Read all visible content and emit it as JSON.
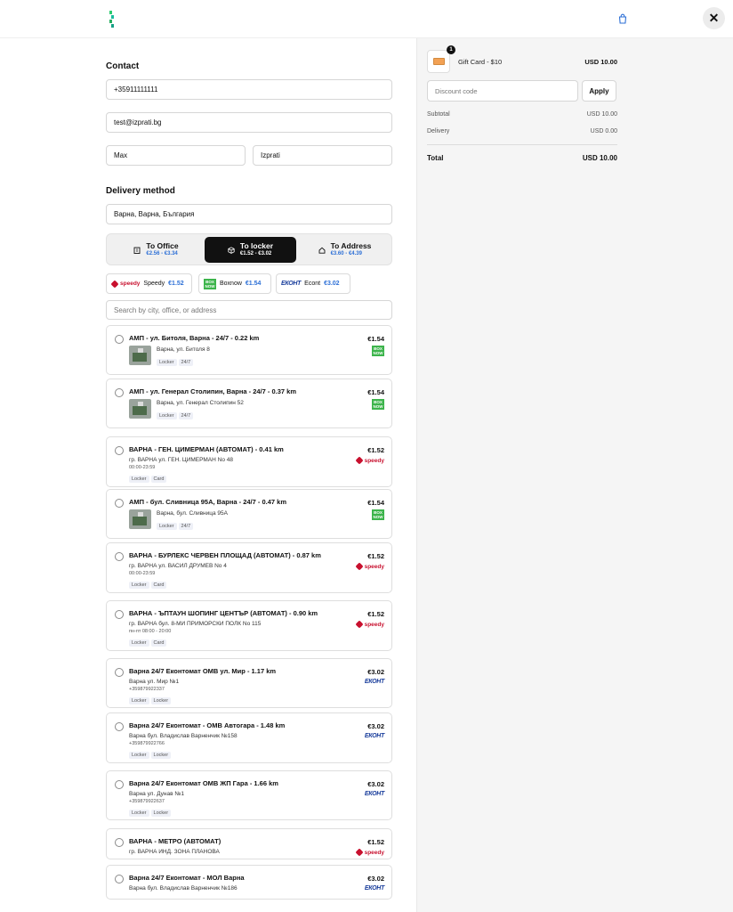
{
  "header": {
    "logo_icon": "izprati-logo",
    "bag_icon": "shopping-bag-icon",
    "close_label": "✕"
  },
  "contact": {
    "title": "Contact",
    "phone": "+35911111111",
    "email": "test@izprati.bg",
    "first_name": "Max",
    "last_name": "Izprati"
  },
  "delivery": {
    "title": "Delivery method",
    "city": "Варна, Варна, България",
    "tabs": [
      {
        "label": "To Office",
        "range": "€2.56 - €3.34",
        "icon": "building-icon"
      },
      {
        "label": "To locker",
        "range": "€1.52 - €3.02",
        "icon": "box-icon"
      },
      {
        "label": "To Address",
        "range": "€3.60 - €4.39",
        "icon": "home-icon"
      }
    ],
    "carriers": [
      {
        "logo": "speedy",
        "name": "Speedy",
        "price": "€1.52"
      },
      {
        "logo": "BOX NOW",
        "name": "Boxnow",
        "price": "€1.54"
      },
      {
        "logo": "ЕКОНТ",
        "name": "Econt",
        "price": "€3.02"
      }
    ],
    "search_placeholder": "Search by city, office, or address",
    "speedy_logo_text": "speedy",
    "boxnow_logo_line1": "BOX",
    "boxnow_logo_line2": "NOW",
    "econt_logo_text": "ЕКОНТ",
    "locations": [
      {
        "name": "АМП - ул. Битоля, Варна - 24/7 - 0.22 km",
        "price": "€1.54",
        "carrier": "boxnow",
        "address": "Варна, ул. Битоля 8",
        "hours": "",
        "tags": [
          "Locker",
          "24/7"
        ]
      },
      {
        "name": "АМП - ул. Генерал Столипин, Варна - 24/7 - 0.37 km",
        "price": "€1.54",
        "carrier": "boxnow",
        "address": "Варна, ул. Генерал Столипин 52",
        "hours": "",
        "tags": [
          "Locker",
          "24/7"
        ]
      },
      {
        "name": "ВАРНА - ГЕН. ЦИМЕРМАН (АВТОМАТ) - 0.41 km",
        "price": "€1.52",
        "carrier": "speedy",
        "address": "гр. ВАРНА ул. ГЕН. ЦИМЕРМАН No 48",
        "hours": "00:00-23:59",
        "tags": [
          "Locker",
          "Card"
        ]
      },
      {
        "name": "АМП - бул. Сливница 95А, Варна - 24/7 - 0.47 km",
        "price": "€1.54",
        "carrier": "boxnow",
        "address": "Варна, бул. Сливница 95А",
        "hours": "",
        "tags": [
          "Locker",
          "24/7"
        ]
      },
      {
        "name": "ВАРНА - БУРЛЕКС ЧЕРВЕН ПЛОЩАД (АВТОМАТ) - 0.87 km",
        "price": "€1.52",
        "carrier": "speedy",
        "address": "гр. ВАРНА ул. ВАСИЛ ДРУМЕВ No 4",
        "hours": "00:00-23:59",
        "tags": [
          "Locker",
          "Card"
        ]
      },
      {
        "name": "ВАРНА - ЪПТАУН ШОПИНГ ЦЕНТЪР (АВТОМАТ) - 0.90 km",
        "price": "€1.52",
        "carrier": "speedy",
        "address": "гр. ВАРНА бул. 8-МИ ПРИМОРСКИ ПОЛК No 115",
        "hours": "пн-пт 08:00 - 20:00",
        "tags": [
          "Locker",
          "Card"
        ]
      },
      {
        "name": "Варна 24/7 Еконтомат ОМВ ул. Мир - 1.17 km",
        "price": "€3.02",
        "carrier": "econt",
        "address": "Варна ул. Мир №1",
        "hours": "+359879922337",
        "tags": [
          "Locker",
          "Locker"
        ]
      },
      {
        "name": "Варна 24/7 Еконтомат - ОМВ Автогара - 1.48 km",
        "price": "€3.02",
        "carrier": "econt",
        "address": "Варна бул. Владислав Варненчик №158",
        "hours": "+359879922766",
        "tags": [
          "Locker",
          "Locker"
        ]
      },
      {
        "name": "Варна 24/7 Еконтомат ОМВ ЖП Гара - 1.66 km",
        "price": "€3.02",
        "carrier": "econt",
        "address": "Варна ул. Дунав №1",
        "hours": "+359879922637",
        "tags": [
          "Locker",
          "Locker"
        ]
      },
      {
        "name": "ВАРНА - МЕТРО (АВТОМАТ)",
        "price": "€1.52",
        "carrier": "speedy",
        "address": "гр. ВАРНА ИНД. ЗОНА ПЛАНОВА",
        "hours": "",
        "tags": []
      },
      {
        "name": "Варна 24/7 Еконтомат - МОЛ Варна",
        "price": "€3.02",
        "carrier": "econt",
        "address": "Варна бул. Владислав Варненчик №186",
        "hours": "",
        "tags": []
      }
    ]
  },
  "summary": {
    "item_name": "Gift Card - $10",
    "item_qty": "1",
    "item_price": "USD 10.00",
    "discount_placeholder": "Discount code",
    "apply_label": "Apply",
    "subtotal_label": "Subtotal",
    "subtotal_value": "USD 10.00",
    "delivery_label": "Delivery",
    "delivery_value": "USD 0.00",
    "total_label": "Total",
    "total_value": "USD 10.00"
  }
}
